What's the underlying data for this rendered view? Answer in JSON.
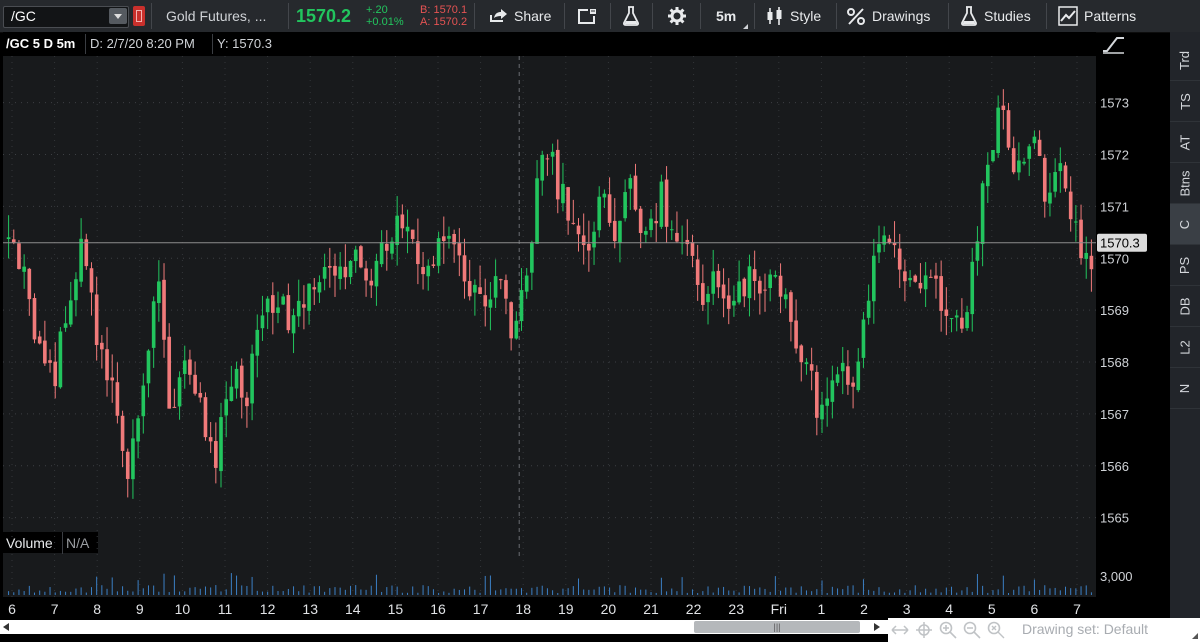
{
  "toolbar": {
    "symbol": "/GC",
    "description": "Gold Futures, ...",
    "last_price": "1570.2",
    "change": "+.20",
    "change_pct": "+0.01%",
    "bid": "B: 1570.1",
    "ask": "A: 1570.2",
    "share_label": "Share",
    "timeframe_label": "5m",
    "style_label": "Style",
    "drawings_label": "Drawings",
    "studies_label": "Studies",
    "patterns_label": "Patterns",
    "icons": [
      "link-icon",
      "share-icon",
      "notes-icon",
      "flask-icon",
      "gear-icon",
      "candle-style-icon",
      "drawings-icon",
      "studies-icon",
      "patterns-icon"
    ]
  },
  "chart_header": {
    "symbol": "/GC 5 D 5m",
    "datetime": "D: 2/7/20 8:20 PM",
    "y_value": "Y: 1570.3"
  },
  "volume_panel": {
    "label": "Volume",
    "value": "N/A",
    "axis_label": "3,000"
  },
  "right_tabs": [
    "Trd",
    "TS",
    "AT",
    "Btns",
    "C",
    "PS",
    "DB",
    "L2",
    "N"
  ],
  "active_right_tab": "C",
  "bottom": {
    "drawing_set": "Drawing set: Default",
    "scroll_thumb": "|||"
  },
  "colors": {
    "up": "#22c55e",
    "down": "#f07a7a",
    "background": "#181a1c",
    "price_line": "#8c8c8c"
  },
  "chart_data": {
    "type": "candlestick",
    "price_axis_ticks": [
      1565,
      1566,
      1567,
      1568,
      1569,
      1570,
      1571,
      1572,
      1573
    ],
    "price_range": [
      1564.8,
      1573.9
    ],
    "current_price_label": "1570.3",
    "current_price": 1570.3,
    "x_tick_labels": [
      "6",
      "7",
      "8",
      "9",
      "10",
      "11",
      "12",
      "13",
      "14",
      "15",
      "16",
      "17",
      "18",
      "19",
      "20",
      "21",
      "22",
      "23",
      "Fri",
      "1",
      "2",
      "3",
      "4",
      "5",
      "6",
      "7"
    ],
    "session_divider_after_label": "18",
    "approx_close_path": [
      1570.3,
      1569.8,
      1568.2,
      1567.6,
      1569.2,
      1570.2,
      1568.5,
      1567.4,
      1565.9,
      1567.2,
      1569.8,
      1566.5,
      1568.3,
      1567.0,
      1566.2,
      1567.8,
      1567.4,
      1568.8,
      1569.3,
      1568.6,
      1569.1,
      1569.8,
      1569.4,
      1570.2,
      1569.5,
      1570.0,
      1570.7,
      1570.4,
      1569.6,
      1570.1,
      1570.3,
      1569.5,
      1569.2,
      1569.6,
      1568.6,
      1569.7,
      1572.3,
      1571.5,
      1570.8,
      1570.2,
      1571.1,
      1570.5,
      1571.4,
      1570.3,
      1571.2,
      1570.4,
      1569.8,
      1569.3,
      1569.6,
      1569.1,
      1569.7,
      1569.4,
      1569.6,
      1568.2,
      1567.6,
      1566.9,
      1568.1,
      1567.3,
      1569.4,
      1570.5,
      1569.8,
      1569.2,
      1570.1,
      1568.9,
      1568.6,
      1569.7,
      1572.1,
      1572.9,
      1571.6,
      1572.3,
      1571.2,
      1571.6,
      1570.3,
      1569.8
    ],
    "volume_axis": [
      0,
      3000
    ]
  }
}
